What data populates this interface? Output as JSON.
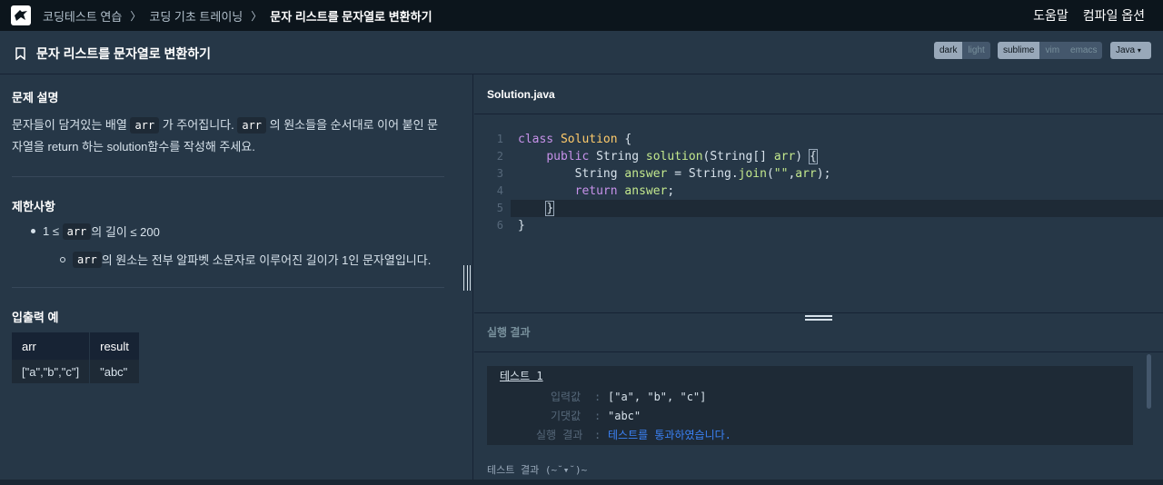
{
  "nav": {
    "breadcrumbs": [
      "코딩테스트 연습",
      "코딩 기초 트레이닝",
      "문자 리스트를 문자열로 변환하기"
    ],
    "help": "도움말",
    "compile_options": "컴파일 옵션"
  },
  "title": "문자 리스트를 문자열로 변환하기",
  "themes": [
    "dark",
    "light"
  ],
  "keymaps": [
    "sublime",
    "vim",
    "emacs"
  ],
  "language": "Java",
  "problem": {
    "heading": "문제 설명",
    "desc_parts": [
      "문자들이 담겨있는 배열 ",
      "arr",
      " 가 주어집니다. ",
      "arr",
      " 의 원소들을 순서대로 이어 붙인 문자열을 return 하는 solution함수를 작성해 주세요."
    ],
    "constraints_heading": "제한사항",
    "c1_pre": "1 ≤ ",
    "c1_code": "arr",
    "c1_post": " 의 길이 ≤ 200",
    "c2_code": "arr",
    "c2_post": " 의 원소는 전부 알파벳 소문자로 이루어진 길이가 1인 문자열입니다.",
    "io_heading": "입출력 예",
    "io_headers": [
      "arr",
      "result"
    ],
    "io_row": [
      "[\"a\",\"b\",\"c\"]",
      "\"abc\""
    ]
  },
  "editor": {
    "file": "Solution.java",
    "line_numbers": [
      "1",
      "2",
      "3",
      "4",
      "5",
      "6"
    ]
  },
  "result": {
    "heading": "실행 결과",
    "test_name": "테스트 1",
    "input_label": "입력값",
    "input_value": "[\"a\", \"b\", \"c\"]",
    "expected_label": "기댓값",
    "expected_value": "\"abc\"",
    "result_label": "실행 결과",
    "result_value": "테스트를 통과하였습니다.",
    "summary": "테스트 결과 (~˘▾˘)~"
  }
}
